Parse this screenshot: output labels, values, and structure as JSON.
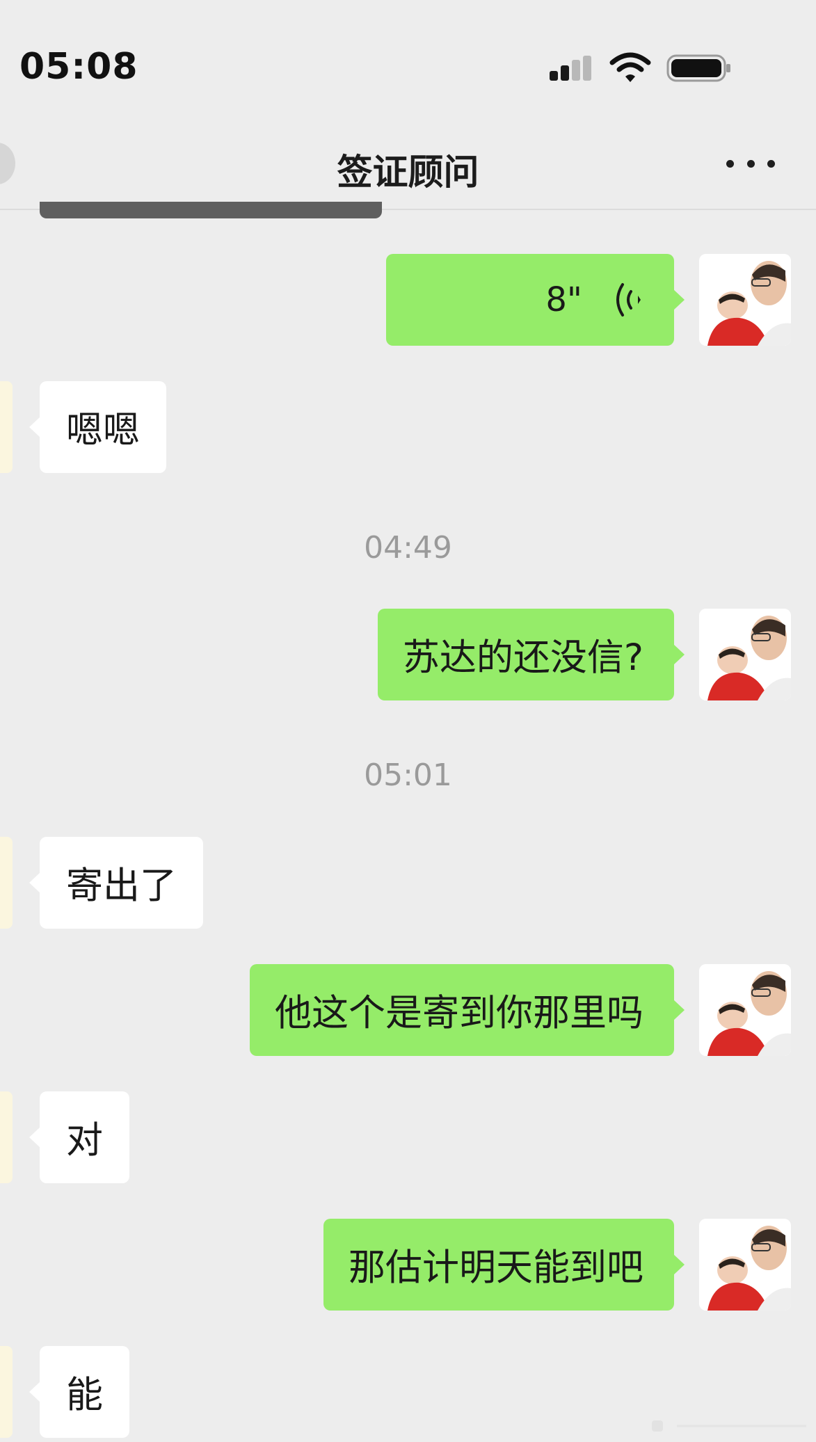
{
  "status_bar": {
    "time": "05:08"
  },
  "nav": {
    "title": "签证顾问"
  },
  "messages": [
    {
      "side": "me",
      "type": "voice",
      "duration": "8\""
    },
    {
      "side": "them",
      "text": "嗯嗯"
    },
    {
      "timestamp": "04:49"
    },
    {
      "side": "me",
      "text": "苏达的还没信?"
    },
    {
      "timestamp": "05:01"
    },
    {
      "side": "them",
      "text": "寄出了"
    },
    {
      "side": "me",
      "text": "他这个是寄到你那里吗"
    },
    {
      "side": "them",
      "text": "对"
    },
    {
      "side": "me",
      "text": "那估计明天能到吧"
    },
    {
      "side": "them",
      "text": "能"
    }
  ],
  "colors": {
    "my_bubble": "#95ec69",
    "their_bubble": "#ffffff",
    "background": "#ededed"
  },
  "icons": [
    "signal-icon",
    "wifi-icon",
    "battery-icon",
    "more-icon",
    "voice-wave-icon",
    "avatar"
  ]
}
